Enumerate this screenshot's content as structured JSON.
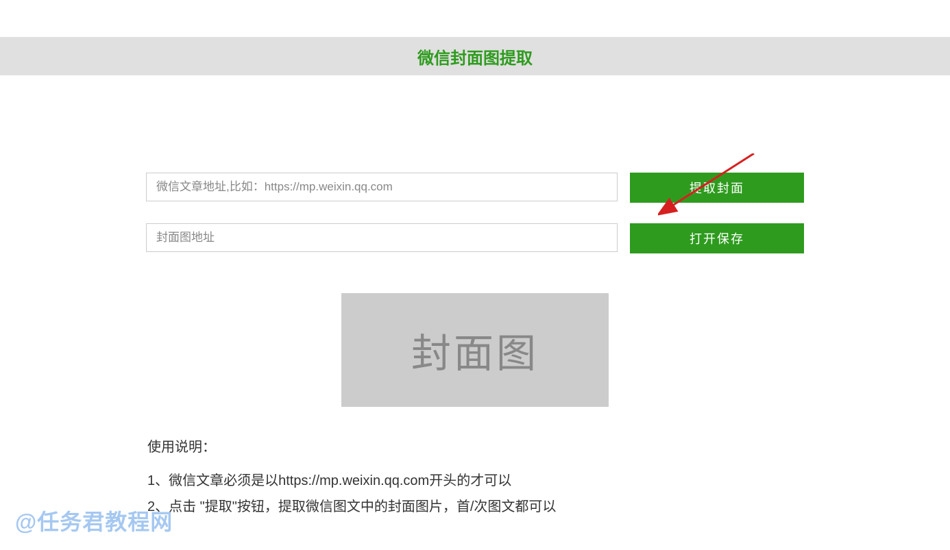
{
  "header": {
    "title": "微信封面图提取"
  },
  "form": {
    "article_url_placeholder": "微信文章地址,比如：https://mp.weixin.qq.com",
    "article_url_value": "",
    "cover_url_placeholder": "封面图地址",
    "cover_url_value": "",
    "extract_button": "提取封面",
    "open_save_button": "打开保存"
  },
  "preview": {
    "placeholder_text": "封面图"
  },
  "instructions": {
    "title": "使用说明：",
    "items": [
      "1、微信文章必须是以https://mp.weixin.qq.com开头的才可以",
      "2、点击 \"提取\"按钮，提取微信图文中的封面图片，首/次图文都可以"
    ]
  },
  "watermark": "@任务君教程网",
  "colors": {
    "accent": "#2e9b1e",
    "button_bg": "#2e9b1e",
    "header_bg": "#e0e0e0",
    "preview_bg": "#cccccc",
    "arrow": "#d62020"
  }
}
